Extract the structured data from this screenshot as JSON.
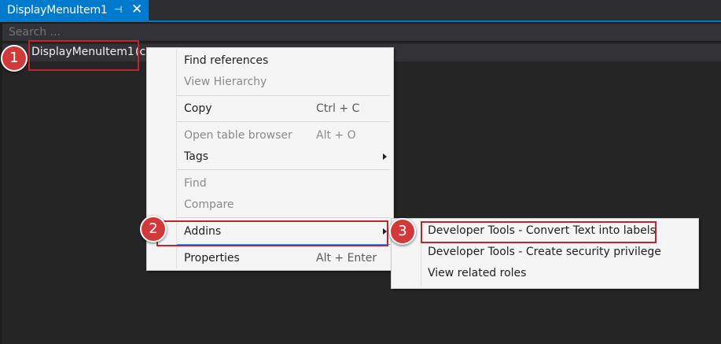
{
  "tab": {
    "title": "DisplayMenuItem1",
    "pin_icon": "⊣",
    "close_icon": "✕"
  },
  "search": {
    "placeholder": "Search ..."
  },
  "tree": {
    "item_label": "DisplayMenuItem1",
    "item_suffix": "(c"
  },
  "badges": [
    "1",
    "2",
    "3"
  ],
  "context_menu": {
    "find_references": "Find references",
    "view_hierarchy": "View Hierarchy",
    "copy": "Copy",
    "copy_shortcut": "Ctrl + C",
    "open_table_browser": "Open table browser",
    "open_table_browser_shortcut": "Alt + O",
    "tags": "Tags",
    "find": "Find",
    "compare": "Compare",
    "addins": "Addins",
    "properties": "Properties",
    "properties_shortcut": "Alt + Enter"
  },
  "submenu": {
    "convert_text": "Developer Tools - Convert Text into labels",
    "create_security": "Developer Tools - Create security privilege",
    "view_roles": "View related roles"
  },
  "colors": {
    "accent": "#007acc",
    "highlight_red": "#c4232b",
    "badge_red": "#d13a3a"
  }
}
